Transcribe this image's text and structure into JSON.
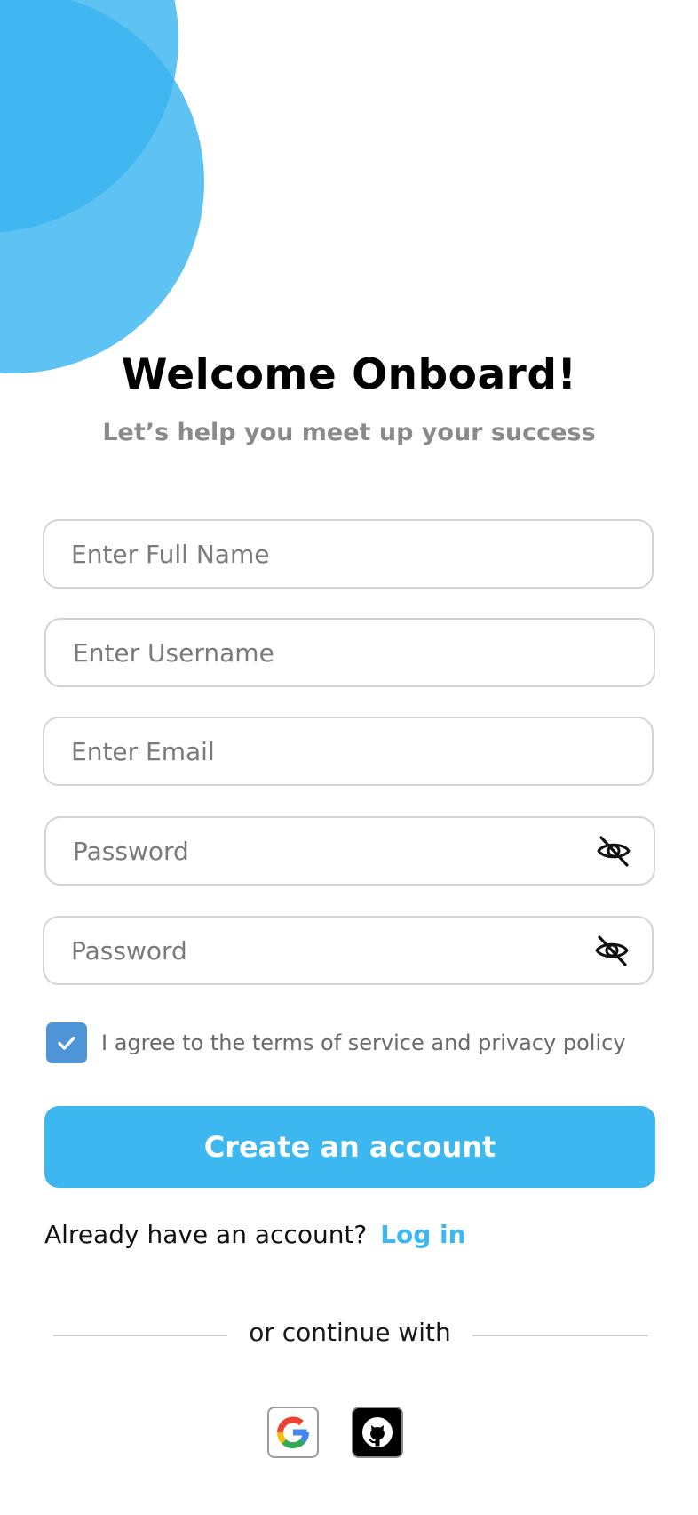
{
  "header": {
    "title": "Welcome Onboard!",
    "subtitle": "Let’s help you meet up your success"
  },
  "form": {
    "full_name": {
      "value": "",
      "placeholder": "Enter Full Name"
    },
    "username": {
      "value": "",
      "placeholder": "Enter Username"
    },
    "email": {
      "value": "",
      "placeholder": "Enter Email"
    },
    "password": {
      "value": "",
      "placeholder": "Password",
      "icon": "eye-off-icon"
    },
    "confirm_password": {
      "value": "",
      "placeholder": "Password",
      "icon": "eye-off-icon"
    },
    "agree": {
      "checked": true,
      "label": "I agree to the terms of service and privacy policy"
    },
    "submit_label": "Create an account"
  },
  "login": {
    "prompt": "Already have an account?",
    "link_label": "Log in"
  },
  "divider": {
    "label": "or continue with"
  },
  "social": [
    {
      "name": "google",
      "icon": "google-icon"
    },
    {
      "name": "github",
      "icon": "github-icon"
    }
  ],
  "colors": {
    "accent": "#3db7ef",
    "checkbox": "#4d95d6",
    "blob": "#3bb4f0",
    "subtitle": "#8a8a8a",
    "border": "#d3d3d3"
  }
}
